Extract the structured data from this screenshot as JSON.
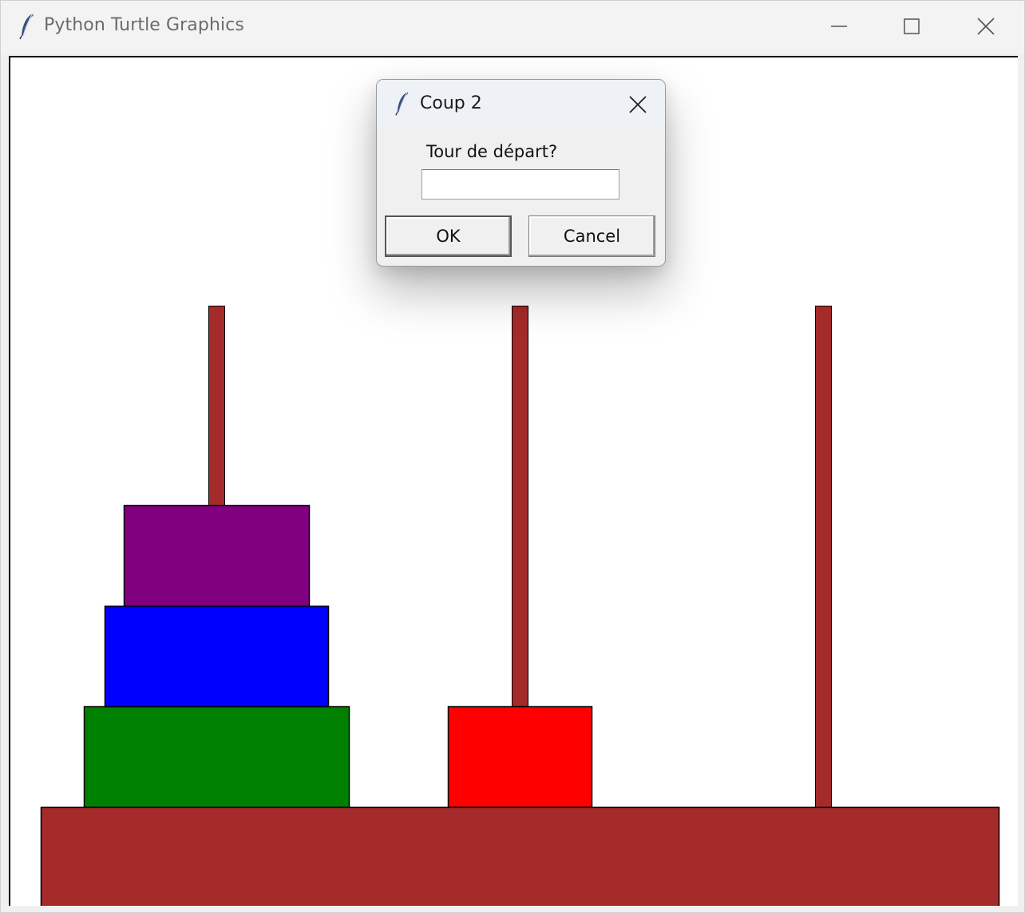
{
  "window": {
    "title": "Python Turtle Graphics",
    "icon": "tk-feather-icon",
    "controls": [
      "minimize-icon",
      "maximize-icon",
      "close-icon"
    ]
  },
  "dialog": {
    "title": "Coup 2",
    "icon": "tk-feather-icon",
    "prompt": "Tour de départ?",
    "input_value": "",
    "ok_label": "OK",
    "cancel_label": "Cancel"
  },
  "game": {
    "towers": 3,
    "colors": {
      "base": "#a52a2a",
      "peg": "#a52a2a",
      "outline": "#000000"
    },
    "disks": [
      {
        "color": "#008000",
        "tower": 1,
        "level": 1
      },
      {
        "color": "#0000ff",
        "tower": 1,
        "level": 2
      },
      {
        "color": "#800080",
        "tower": 1,
        "level": 3
      },
      {
        "color": "#ff0000",
        "tower": 2,
        "level": 1
      }
    ]
  }
}
